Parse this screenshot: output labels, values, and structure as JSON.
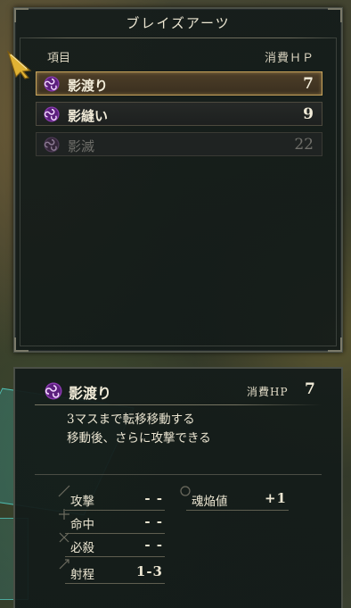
{
  "skill_list": {
    "title": "ブレイズアーツ",
    "column_item": "項目",
    "column_cost": "消費ＨＰ",
    "items": [
      {
        "name": "影渡り",
        "cost": "7",
        "state": "selected"
      },
      {
        "name": "影縫い",
        "cost": "9",
        "state": "normal"
      },
      {
        "name": "影滅",
        "cost": "22",
        "state": "disabled"
      }
    ]
  },
  "detail": {
    "name": "影渡り",
    "cost_label": "消費HP",
    "cost": "7",
    "description_line1": "3マスまで転移移動する",
    "description_line2": "移動後、さらに攻撃できる",
    "stats": {
      "attack_label": "攻撃",
      "attack_value": "- -",
      "hit_label": "命中",
      "hit_value": "- -",
      "crit_label": "必殺",
      "crit_value": "- -",
      "range_label": "射程",
      "range_value": "1-3",
      "soulflame_label": "魂焔値",
      "soulflame_value": "+1"
    }
  },
  "colors": {
    "selected_border": "#c6a25a",
    "icon_purple": "#8a3bb0",
    "cursor_gold": "#e0b234"
  }
}
